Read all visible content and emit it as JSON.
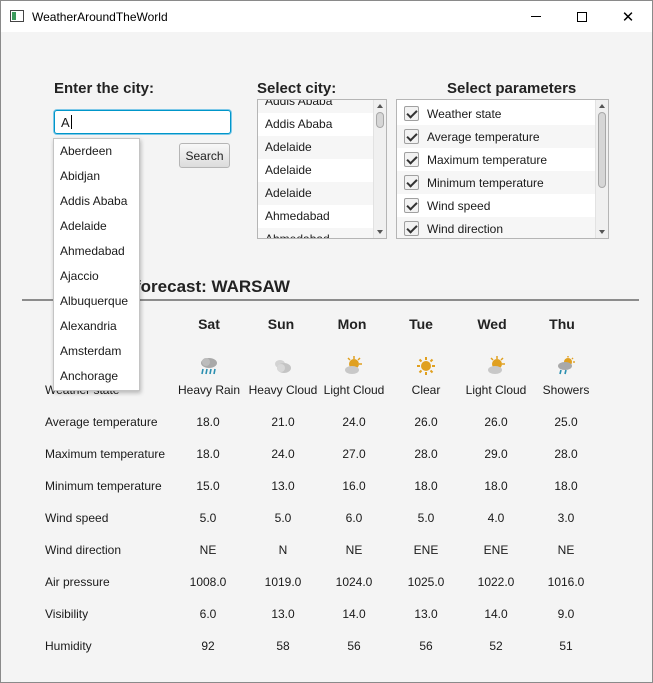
{
  "window": {
    "title": "WeatherAroundTheWorld",
    "minimize_glyph": "",
    "maximize_glyph": "",
    "close_glyph": "✕"
  },
  "city_entry": {
    "heading": "Enter the city:",
    "value": "A",
    "search_label": "Search",
    "suggestions": [
      "Aberdeen",
      "Abidjan",
      "Addis Ababa",
      "Adelaide",
      "Ahmedabad",
      "Ajaccio",
      "Albuquerque",
      "Alexandria",
      "Amsterdam",
      "Anchorage"
    ]
  },
  "city_select": {
    "heading": "Select city:",
    "items": [
      "Addis Ababa",
      "Addis Ababa",
      "Adelaide",
      "Adelaide",
      "Adelaide",
      "Ahmedabad",
      "Ahmedabad"
    ]
  },
  "parameter_select": {
    "heading": "Select parameters",
    "items": [
      {
        "label": "Weather state",
        "checked": true
      },
      {
        "label": "Average temperature",
        "checked": true
      },
      {
        "label": "Maximum temperature",
        "checked": true
      },
      {
        "label": "Minimum temperature",
        "checked": true
      },
      {
        "label": "Wind speed",
        "checked": true
      },
      {
        "label": "Wind direction",
        "checked": true
      }
    ]
  },
  "forecast": {
    "title": "forecast: WARSAW",
    "days": [
      {
        "day": "Sat",
        "condition": "Heavy Rain",
        "icon": "heavy-rain-icon"
      },
      {
        "day": "Sun",
        "condition": "Heavy Cloud",
        "icon": "heavy-cloud-icon"
      },
      {
        "day": "Mon",
        "condition": "Light Cloud",
        "icon": "light-cloud-icon"
      },
      {
        "day": "Tue",
        "condition": "Clear",
        "icon": "sun-icon"
      },
      {
        "day": "Wed",
        "condition": "Light Cloud",
        "icon": "light-cloud-icon"
      },
      {
        "day": "Thu",
        "condition": "Showers",
        "icon": "showers-icon"
      }
    ],
    "weather_state_label": "Weather state",
    "rows": [
      {
        "label": "Average temperature",
        "values": [
          "18.0",
          "21.0",
          "24.0",
          "26.0",
          "26.0",
          "25.0"
        ]
      },
      {
        "label": "Maximum temperature",
        "values": [
          "18.0",
          "24.0",
          "27.0",
          "28.0",
          "29.0",
          "28.0"
        ]
      },
      {
        "label": "Minimum temperature",
        "values": [
          "15.0",
          "13.0",
          "16.0",
          "18.0",
          "18.0",
          "18.0"
        ]
      },
      {
        "label": "Wind speed",
        "values": [
          "5.0",
          "5.0",
          "6.0",
          "5.0",
          "4.0",
          "3.0"
        ]
      },
      {
        "label": "Wind direction",
        "values": [
          "NE",
          "N",
          "NE",
          "ENE",
          "ENE",
          "NE"
        ]
      },
      {
        "label": "Air pressure",
        "values": [
          "1008.0",
          "1019.0",
          "1024.0",
          "1025.0",
          "1022.0",
          "1016.0"
        ]
      },
      {
        "label": "Visibility",
        "values": [
          "6.0",
          "13.0",
          "14.0",
          "13.0",
          "14.0",
          "9.0"
        ]
      },
      {
        "label": "Humidity",
        "values": [
          "92",
          "58",
          "56",
          "56",
          "52",
          "51"
        ]
      }
    ]
  },
  "colors": {
    "focus_border": "#0096c9",
    "sun": "#e0a020",
    "cloud": "#b8b8b8",
    "rain": "#2a8fb0"
  }
}
